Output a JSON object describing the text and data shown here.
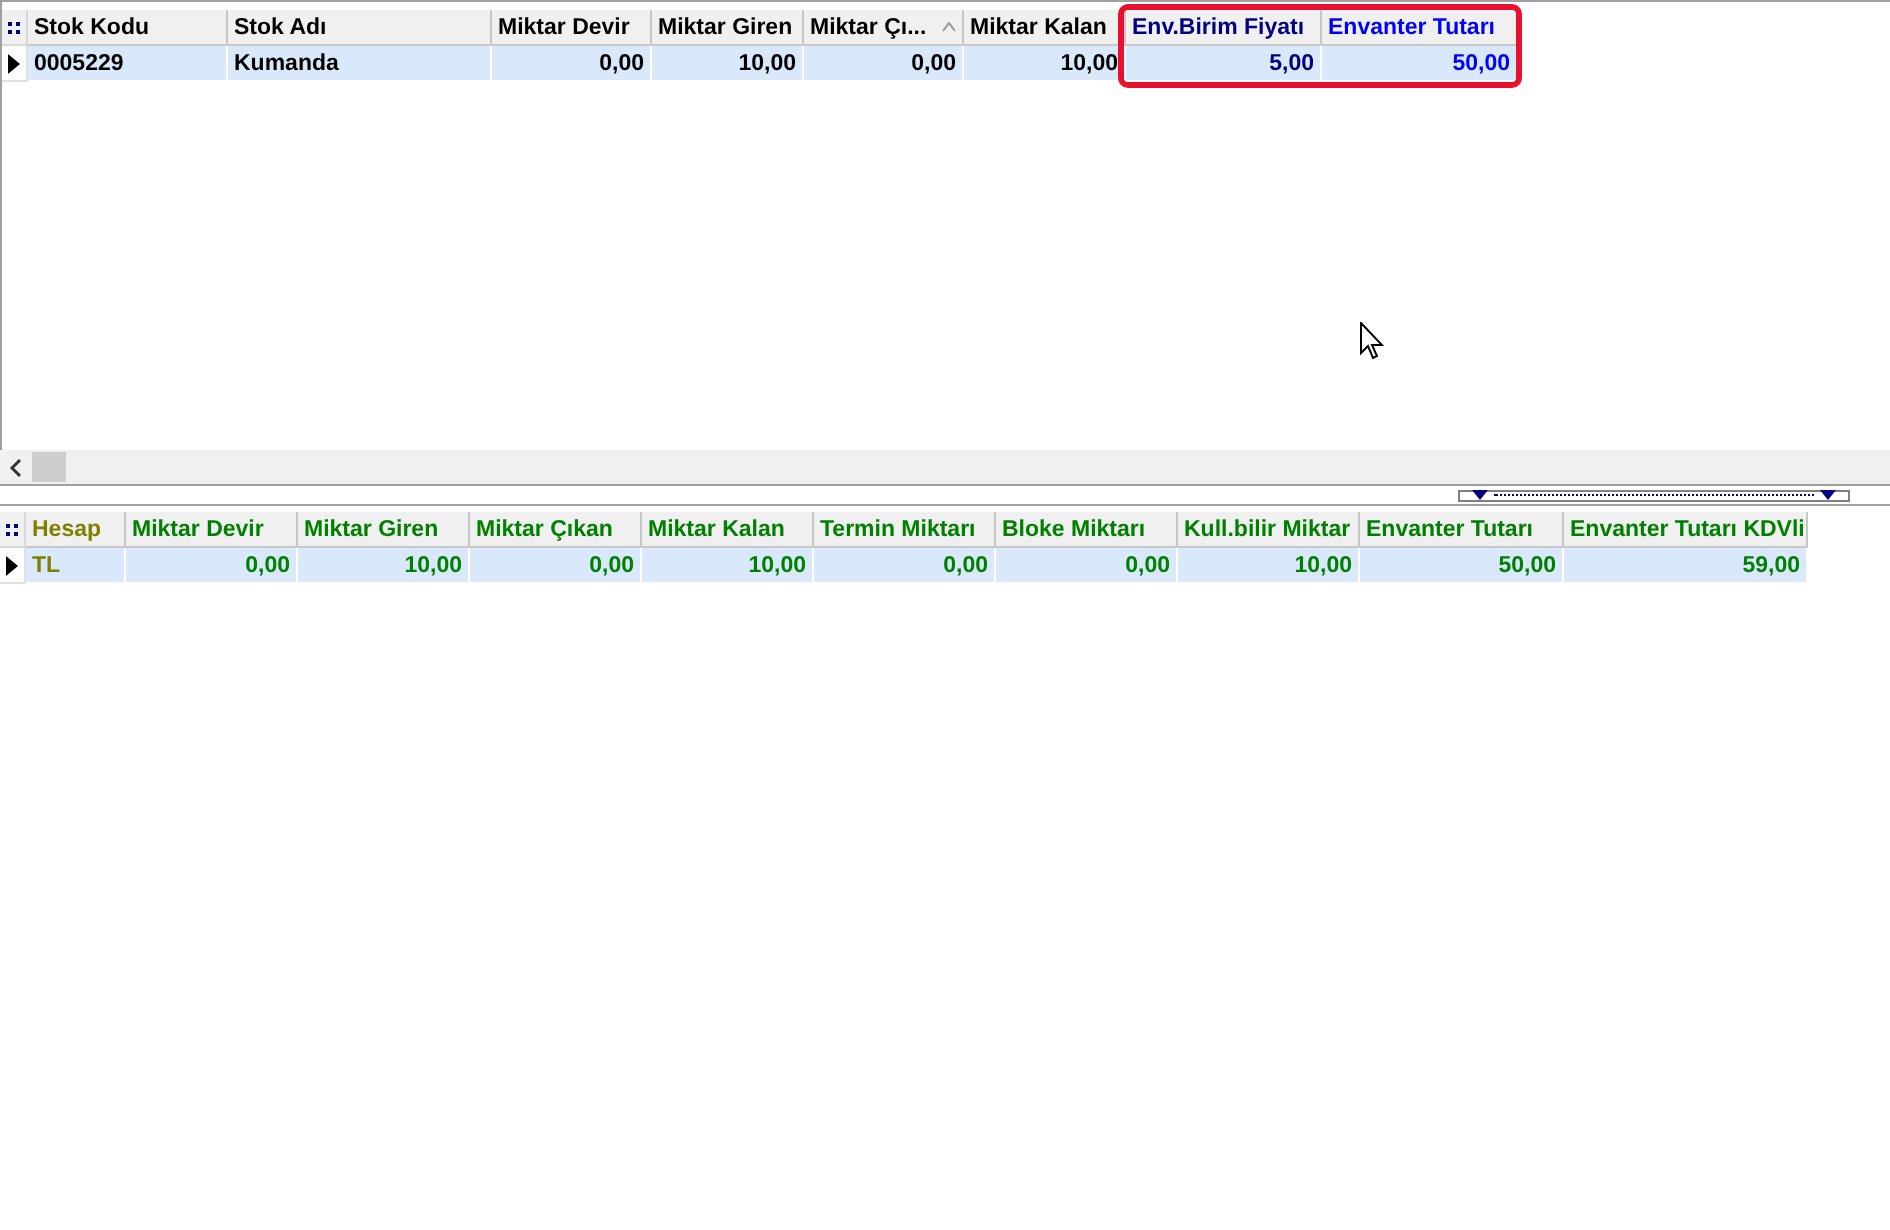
{
  "stock_grid": {
    "columns": [
      {
        "label": "Stok Kodu",
        "color": "#000000",
        "sorted": false,
        "highlighted": false
      },
      {
        "label": "Stok Adı",
        "color": "#000000",
        "sorted": false,
        "highlighted": false
      },
      {
        "label": "Miktar Devir",
        "color": "#000000",
        "sorted": false,
        "highlighted": false
      },
      {
        "label": "Miktar Giren",
        "color": "#000000",
        "sorted": false,
        "highlighted": false
      },
      {
        "label": "Miktar Çı...",
        "color": "#000000",
        "sorted": true,
        "highlighted": false
      },
      {
        "label": "Miktar Kalan",
        "color": "#000000",
        "sorted": false,
        "highlighted": false
      },
      {
        "label": "Env.Birim Fiyatı",
        "color": "#000080",
        "sorted": false,
        "highlighted": true
      },
      {
        "label": "Envanter Tutarı",
        "color": "#0000ff",
        "sorted": false,
        "highlighted": true
      }
    ],
    "rows": [
      {
        "selected": true,
        "cells": [
          "0005229",
          "Kumanda",
          "0,00",
          "10,00",
          "0,00",
          "10,00",
          "5,00",
          "50,00"
        ]
      }
    ]
  },
  "summary_grid": {
    "columns": [
      {
        "label": "Hesap",
        "color": "#808000"
      },
      {
        "label": "Miktar Devir",
        "color": "#008000"
      },
      {
        "label": "Miktar Giren",
        "color": "#008000"
      },
      {
        "label": "Miktar Çıkan",
        "color": "#008000"
      },
      {
        "label": "Miktar Kalan",
        "color": "#008000"
      },
      {
        "label": "Termin Miktarı",
        "color": "#008000"
      },
      {
        "label": "Bloke Miktarı",
        "color": "#008000"
      },
      {
        "label": "Kull.bilir Miktar",
        "color": "#008000"
      },
      {
        "label": "Envanter Tutarı",
        "color": "#008000"
      },
      {
        "label": "Envanter Tutarı KDVli",
        "color": "#008000"
      }
    ],
    "rows": [
      {
        "selected": true,
        "cells": [
          "TL",
          "0,00",
          "10,00",
          "0,00",
          "10,00",
          "0,00",
          "0,00",
          "10,00",
          "50,00",
          "59,00"
        ]
      }
    ]
  }
}
